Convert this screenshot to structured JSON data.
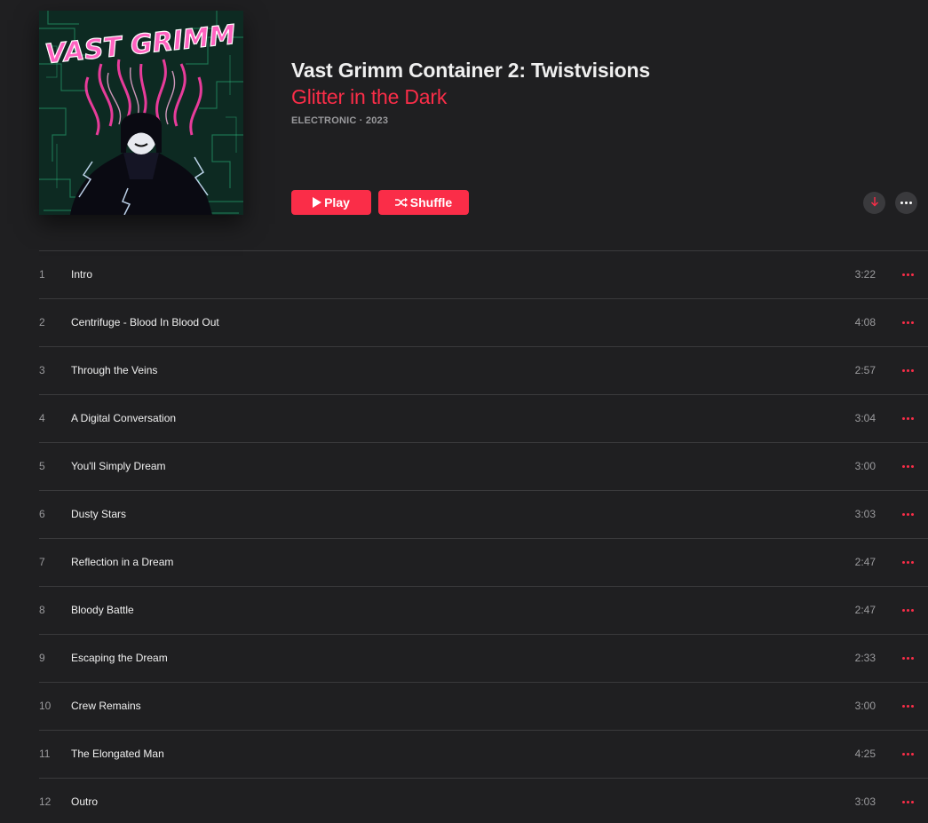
{
  "album": {
    "title": "Vast Grimm Container 2: Twistvisions",
    "artist": "Glitter in the Dark",
    "meta": "ELECTRONIC · 2023",
    "cover_text": "VAST GRIMM"
  },
  "actions": {
    "play_label": "Play",
    "shuffle_label": "Shuffle"
  },
  "colors": {
    "accent": "#fa2d48",
    "background": "#1f1f21",
    "divider": "#3a3a3c"
  },
  "tracks": [
    {
      "number": "1",
      "title": "Intro",
      "duration": "3:22"
    },
    {
      "number": "2",
      "title": "Centrifuge - Blood In Blood Out",
      "duration": "4:08"
    },
    {
      "number": "3",
      "title": "Through the Veins",
      "duration": "2:57"
    },
    {
      "number": "4",
      "title": "A Digital Conversation",
      "duration": "3:04"
    },
    {
      "number": "5",
      "title": "You'll Simply Dream",
      "duration": "3:00"
    },
    {
      "number": "6",
      "title": "Dusty Stars",
      "duration": "3:03"
    },
    {
      "number": "7",
      "title": "Reflection in a Dream",
      "duration": "2:47"
    },
    {
      "number": "8",
      "title": "Bloody Battle",
      "duration": "2:47"
    },
    {
      "number": "9",
      "title": "Escaping the Dream",
      "duration": "2:33"
    },
    {
      "number": "10",
      "title": "Crew Remains",
      "duration": "3:00"
    },
    {
      "number": "11",
      "title": "The Elongated Man",
      "duration": "4:25"
    },
    {
      "number": "12",
      "title": "Outro",
      "duration": "3:03"
    }
  ],
  "icons": {
    "play": "play-icon",
    "shuffle": "shuffle-icon",
    "download": "download-arrow-icon",
    "more": "more-ellipsis-icon"
  }
}
